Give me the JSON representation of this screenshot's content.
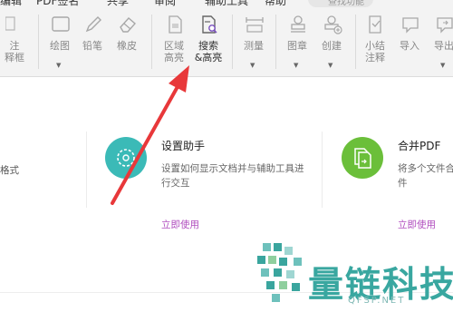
{
  "menu": {
    "tabs": [
      "编辑",
      "PDF签名",
      "共享",
      "审阅",
      "辅助工具",
      "帮助"
    ],
    "search_placeholder": "查找功能"
  },
  "toolbar": {
    "items": [
      {
        "label": "注\n释框",
        "icon": "comment-box-icon"
      },
      {
        "label": "绘图",
        "icon": "drawing-icon",
        "has_dropdown": true
      },
      {
        "label": "铅笔",
        "icon": "pencil-icon"
      },
      {
        "label": "橡皮",
        "icon": "eraser-icon"
      },
      {
        "label": "区域\n高亮",
        "icon": "area-highlight-icon"
      },
      {
        "label": "搜索\n&高亮",
        "icon": "search-highlight-icon"
      },
      {
        "label": "测量",
        "icon": "measure-icon",
        "has_dropdown": true
      },
      {
        "label": "图章",
        "icon": "stamp-icon",
        "has_dropdown": true
      },
      {
        "label": "创建",
        "icon": "create-stamp-icon",
        "has_dropdown": true
      },
      {
        "label": "小结\n注释",
        "icon": "summarize-comments-icon"
      },
      {
        "label": "导入",
        "icon": "import-icon"
      },
      {
        "label": "导出",
        "icon": "export-icon",
        "has_dropdown": true
      }
    ]
  },
  "cards": [
    {
      "partial_text": "格式"
    },
    {
      "title": "设置助手",
      "description": "设置如何显示文档并与辅助工具进行交互",
      "link": "立即使用",
      "icon": "settings-assistant-icon",
      "icon_color": "#3bbab7"
    },
    {
      "title": "合并PDF",
      "description": "将多个文件合\n件",
      "link": "立即使用",
      "icon": "merge-pdf-icon",
      "icon_color": "#6bbf3a"
    }
  ],
  "annotation": {
    "arrow_color": "#e8383a",
    "points_to": "search-highlight-button"
  },
  "watermark": {
    "text": "量链科技",
    "subtext": "QFSP.NET",
    "icon": "mosaic-logo-icon",
    "color": "#39a7a0"
  }
}
